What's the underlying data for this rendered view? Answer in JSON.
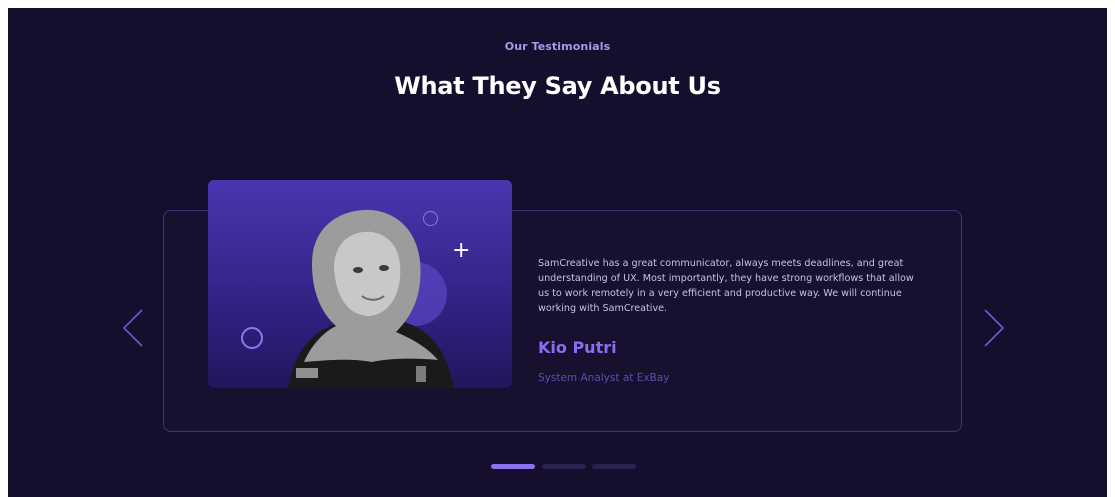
{
  "section": {
    "subtitle": "Our Testimonials",
    "title": "What They Say About Us"
  },
  "testimonial": {
    "quote": "SamCreative has a great communicator, always meets deadlines, and great understanding of UX. Most importantly, they have strong workflows that allow us to work remotely in a very efficient and productive way. We will continue working with SamCreative.",
    "name": "Kio Putri",
    "role": "System Analyst at ExBay"
  },
  "carousel": {
    "slides": 3,
    "active_index": 0
  },
  "icons": {
    "prev": "chevron-left-icon",
    "next": "chevron-right-icon",
    "plus": "plus-icon"
  },
  "colors": {
    "background": "#150e2c",
    "accent": "#8b72f0",
    "card_border": "#3f3380",
    "photo_bg": "#4a36b0"
  }
}
